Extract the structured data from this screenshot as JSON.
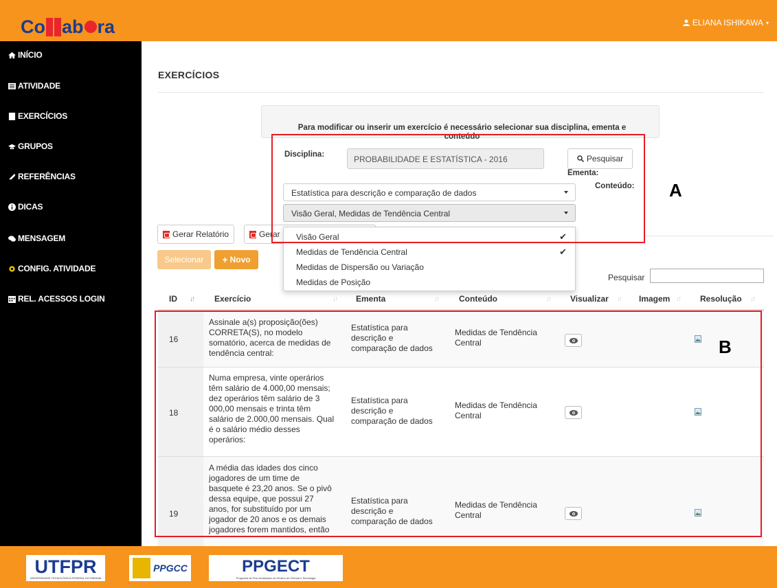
{
  "header": {
    "logo_text": "Collabora",
    "user_name": "ELIANA ISHIKAWA"
  },
  "sidebar": {
    "items": [
      {
        "label": "INÍCIO",
        "icon": "home-icon"
      },
      {
        "label": "ATIVIDADE",
        "icon": "list-icon"
      },
      {
        "label": "EXERCÍCIOS",
        "icon": "book-icon"
      },
      {
        "label": "GRUPOS",
        "icon": "graduation-cap-icon"
      },
      {
        "label": "REFERÊNCIAS",
        "icon": "paperclip-icon"
      },
      {
        "label": "DICAS",
        "icon": "info-icon"
      },
      {
        "label": "MENSAGEM",
        "icon": "comments-icon"
      },
      {
        "label": "CONFIG. ATIVIDADE",
        "icon": "gear-icon"
      },
      {
        "label": "REL. ACESSOS LOGIN",
        "icon": "calendar-icon"
      }
    ]
  },
  "main": {
    "title": "EXERCÍCIOS",
    "info_line1": "Para modificar ou inserir um exercício é necessário selecionar sua disciplina, ementa e",
    "info_line2": "conteúdo",
    "disciplina_label": "Disciplina:",
    "disciplina_value": "PROBABILIDADE E ESTATÍSTICA - 2016",
    "search_button": "Pesquisar",
    "ementa_label": "Ementa:",
    "conteudo_label": "Conteúdo:",
    "ementa_select": "Estatística para descrição e comparação de dados",
    "conteudo_select": "Visão Geral, Medidas de Tendência Central",
    "dropdown_options": [
      {
        "label": "Visão Geral",
        "checked": "✔"
      },
      {
        "label": "Medidas de Tendência Central",
        "checked": "✔"
      },
      {
        "label": "Medidas de Dispersão ou Variação",
        "checked": ""
      },
      {
        "label": "Medidas de Posição",
        "checked": ""
      }
    ],
    "btn_report1": "Gerar Relatório",
    "btn_report2": "Gerar",
    "btn_select": "Selecionar",
    "btn_new": "Novo",
    "search_label": "Pesquisar"
  },
  "table": {
    "headers": [
      "ID",
      "Exercício",
      "Ementa",
      "Conteúdo",
      "Visualizar",
      "Imagem",
      "Resolução"
    ],
    "rows": [
      {
        "id": "16",
        "exercicio": [
          "Assinale a(s) proposição(ões)",
          "CORRETA(S), no modelo",
          "somatório, acerca de medidas de",
          "tendência central:"
        ],
        "ementa": [
          "Estatística para",
          "descrição e",
          "comparação de dados"
        ],
        "conteudo": [
          "Medidas de Tendência",
          "Central"
        ]
      },
      {
        "id": "18",
        "exercicio": [
          "Numa empresa, vinte operários",
          "têm salário de 4.000,00 mensais;",
          "dez operários têm salário de 3",
          "000,00 mensais e trinta têm",
          "salário de 2.000,00 mensais. Qual",
          "é o salário médio desses",
          "operários:"
        ],
        "ementa": [
          "Estatística para",
          "descrição e",
          "comparação de dados"
        ],
        "conteudo": [
          "Medidas de Tendência",
          "Central"
        ]
      },
      {
        "id": "19",
        "exercicio": [
          "A média das idades dos cinco",
          "jogadores de um time de",
          "basquete é 23,20 anos. Se o pivô",
          "dessa equipe, que possui 27",
          "anos, for substituído por um",
          "jogador de 20 anos e os demais",
          "jogadores forem mantidos, então"
        ],
        "ementa": [
          "Estatística para",
          "descrição e",
          "comparação de dados"
        ],
        "conteudo": [
          "Medidas de Tendência",
          "Central"
        ]
      }
    ]
  },
  "annotations": {
    "a": "A",
    "b": "B",
    "color": "#e61c24"
  },
  "footer": {
    "logo1": "UTFPR",
    "logo1_sub": "UNIVERSIDADE TECNOLÓGICA FEDERAL DO PARANÁ",
    "logo2": "PPGCC",
    "logo3": "PPGECT",
    "logo3_sub": "Programa de Pós-Graduação em Ensino de Ciência e Tecnologia"
  },
  "colors": {
    "brand_orange": "#f7941d",
    "sidebar_bg": "#000000"
  }
}
